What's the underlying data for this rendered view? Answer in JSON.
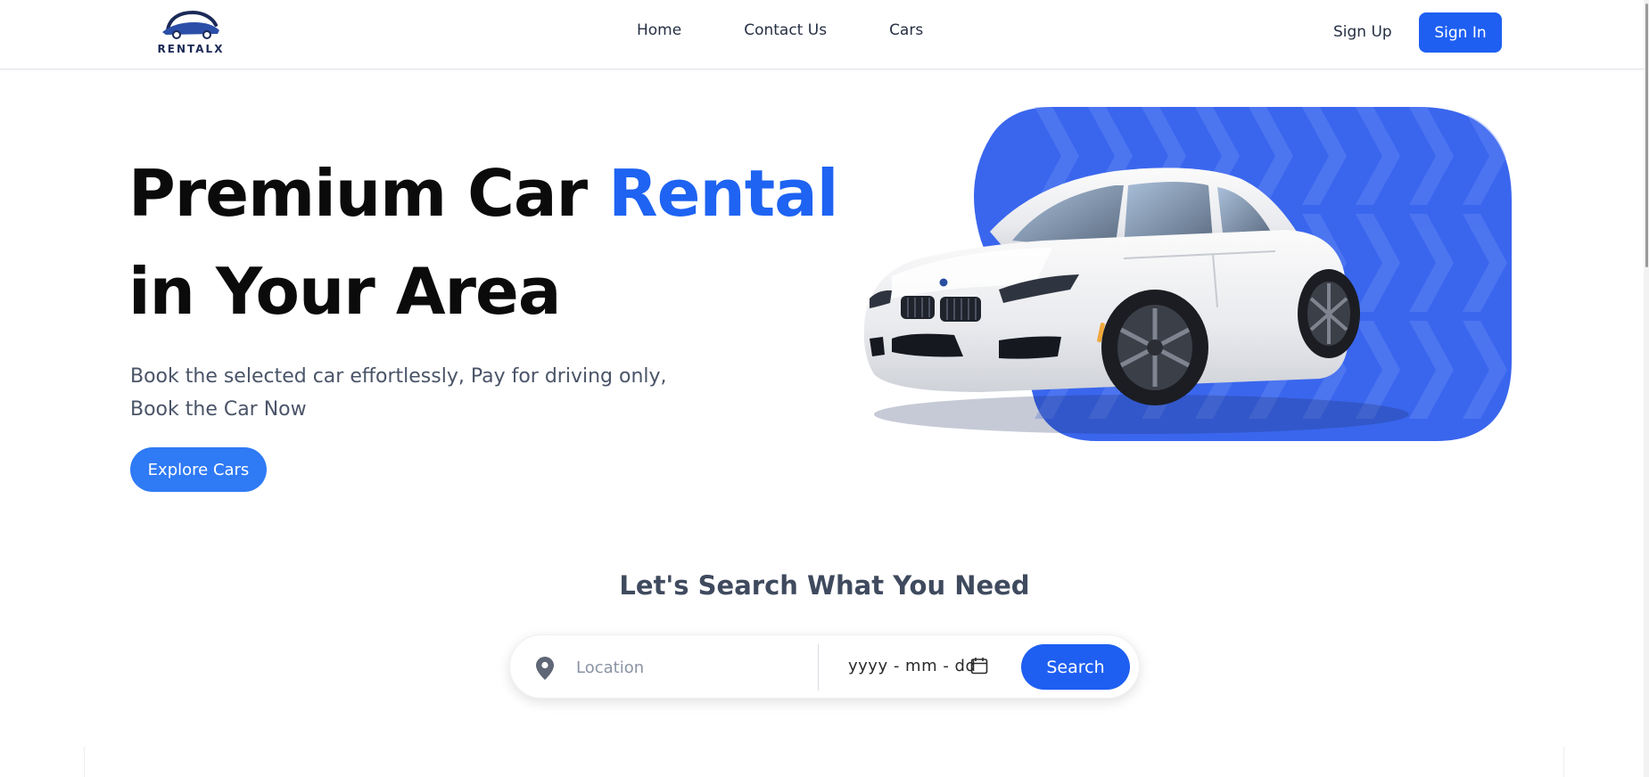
{
  "brand": {
    "name": "RENTALX",
    "color": "#1b2a57"
  },
  "nav": {
    "home": "Home",
    "contact": "Contact Us",
    "cars": "Cars"
  },
  "auth": {
    "signup": "Sign Up",
    "signin": "Sign In"
  },
  "hero": {
    "title_part1": "Premium Car ",
    "title_accent": "Rental",
    "title_line2": "in Your Area",
    "subtitle_line1": "Book the selected car effortlessly, Pay for driving only,",
    "subtitle_line2": "Book the Car Now",
    "cta": "Explore Cars"
  },
  "search": {
    "heading": "Let's Search What You Need",
    "location_placeholder": "Location",
    "date_placeholder": "yyyy - mm - dd",
    "button": "Search"
  },
  "colors": {
    "accent": "#1e63f2",
    "button": "#1e5ff2",
    "explore": "#2f7af5",
    "panel": "#3a66ee"
  },
  "icons": {
    "location": "map-pin-icon",
    "calendar": "calendar-icon",
    "logo": "car-logo-icon"
  }
}
